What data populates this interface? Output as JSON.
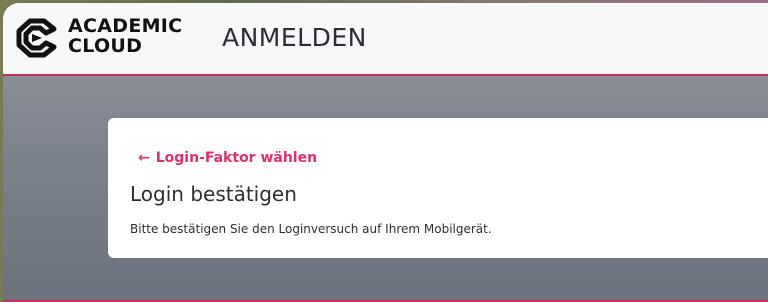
{
  "header": {
    "logo_line1": "ACADEMIC",
    "logo_line2": "CLOUD",
    "logo_icon": "academic-cloud-icon",
    "title": "ANMELDEN"
  },
  "card": {
    "back_arrow": "←",
    "back_label": "Login-Faktor wählen",
    "title": "Login bestätigen",
    "message": "Bitte bestätigen Sie den Loginversuch auf Ihrem Mobilgerät."
  },
  "colors": {
    "accent": "#e0306a",
    "header_border": "#c92d5a",
    "header_bg": "#f7f8fa",
    "text": "#2b2f35"
  }
}
